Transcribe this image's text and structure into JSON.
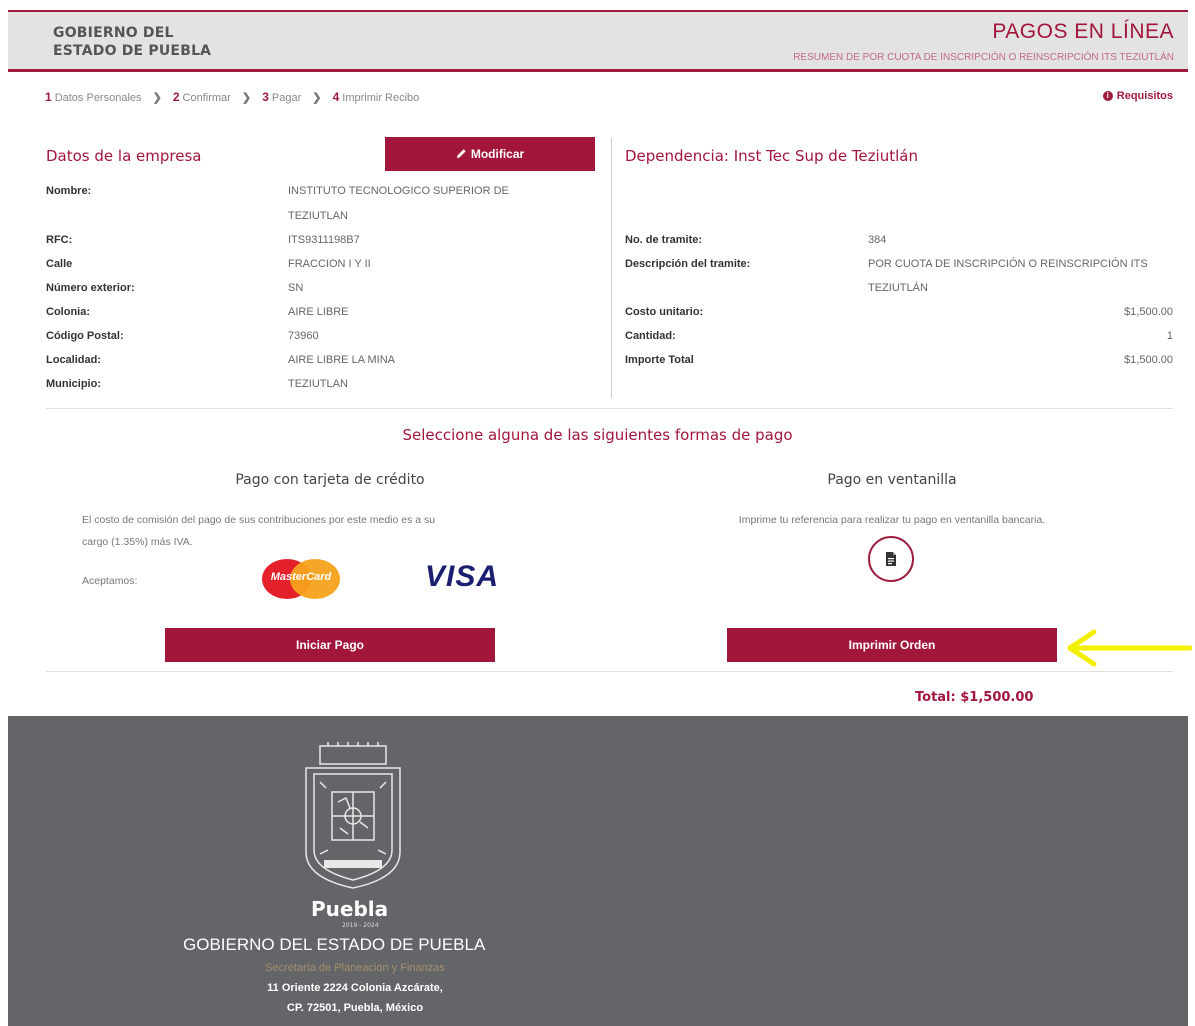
{
  "header": {
    "brand_line1": "GOBIERNO DEL",
    "brand_line2": "ESTADO DE PUEBLA",
    "title": "PAGOS EN LÍNEA",
    "subtitle": "RESUMEN DE POR CUOTA DE INSCRIPCIÓN O REINSCRIPCIÓN ITS TEZIUTLÁN"
  },
  "steps": [
    {
      "num": "1",
      "label": "Datos Personales"
    },
    {
      "num": "2",
      "label": "Confirmar"
    },
    {
      "num": "3",
      "label": "Pagar"
    },
    {
      "num": "4",
      "label": "Imprimir Recibo"
    }
  ],
  "requisitos": "Requisitos",
  "empresa": {
    "title": "Datos de la empresa",
    "modify_label": "Modificar",
    "nombre_label": "Nombre:",
    "nombre_line1": "INSTITUTO TECNOLOGICO SUPERIOR DE",
    "nombre_line2": "TEZIUTLAN",
    "rfc_label": "RFC:",
    "rfc": "ITS9311198B7",
    "calle_label": "Calle",
    "calle": "FRACCION I Y II",
    "num_ext_label": "Número exterior:",
    "num_ext": "SN",
    "colonia_label": "Colonia:",
    "colonia": "AIRE LIBRE",
    "cp_label": "Código Postal:",
    "cp": "73960",
    "localidad_label": "Localidad:",
    "localidad": "AIRE LIBRE LA MINA",
    "municipio_label": "Municipio:",
    "municipio": "TEZIUTLAN"
  },
  "dependencia": {
    "title": "Dependencia: Inst Tec Sup de Teziutlán",
    "tramite_label": "No. de tramite:",
    "tramite": "384",
    "desc_label": "Descripción del tramite:",
    "desc_line1": "POR CUOTA DE INSCRIPCIÓN O REINSCRIPCIÓN ITS",
    "desc_line2": "TEZIUTLÁN",
    "costo_label": "Costo unitario:",
    "costo": "$1,500.00",
    "cantidad_label": "Cantidad:",
    "cantidad": "1",
    "importe_label": "Importe Total",
    "importe": "$1,500.00"
  },
  "payment": {
    "heading": "Seleccione alguna de las siguientes formas de pago",
    "card_title": "Pago con tarjeta de crédito",
    "card_desc_line1": "El costo de comisión del pago de sus contribuciones por este medio es a su",
    "card_desc_line2": "cargo (1.35%) más IVA.",
    "accept_label": "Aceptamos:",
    "mastercard_text": "MasterCard",
    "visa_text": "VISA",
    "start_button": "Iniciar Pago",
    "window_title": "Pago en ventanilla",
    "window_desc": "Imprime tu referencia para realizar tu pago en ventanilla bancaria.",
    "print_button": "Imprimir Orden",
    "total": "Total: $1,500.00"
  },
  "footer": {
    "puebla": "Puebla",
    "years": "2019 - 2024",
    "gov_name": "GOBIERNO DEL ESTADO DE PUEBLA",
    "secretaria": "Secretaría de Planeación y Finanzas",
    "address_line1": "11 Oriente 2224 Colonia Azcárate,",
    "address_line2": "CP. 72501, Puebla, México"
  },
  "colors": {
    "brand": "#a3163c",
    "footer_bg": "#646569",
    "arrow": "#f5f000"
  },
  "icons": {
    "modify": "pencil-icon",
    "requisitos": "info-icon",
    "document": "document-icon",
    "pointer": "arrow-left-icon"
  }
}
